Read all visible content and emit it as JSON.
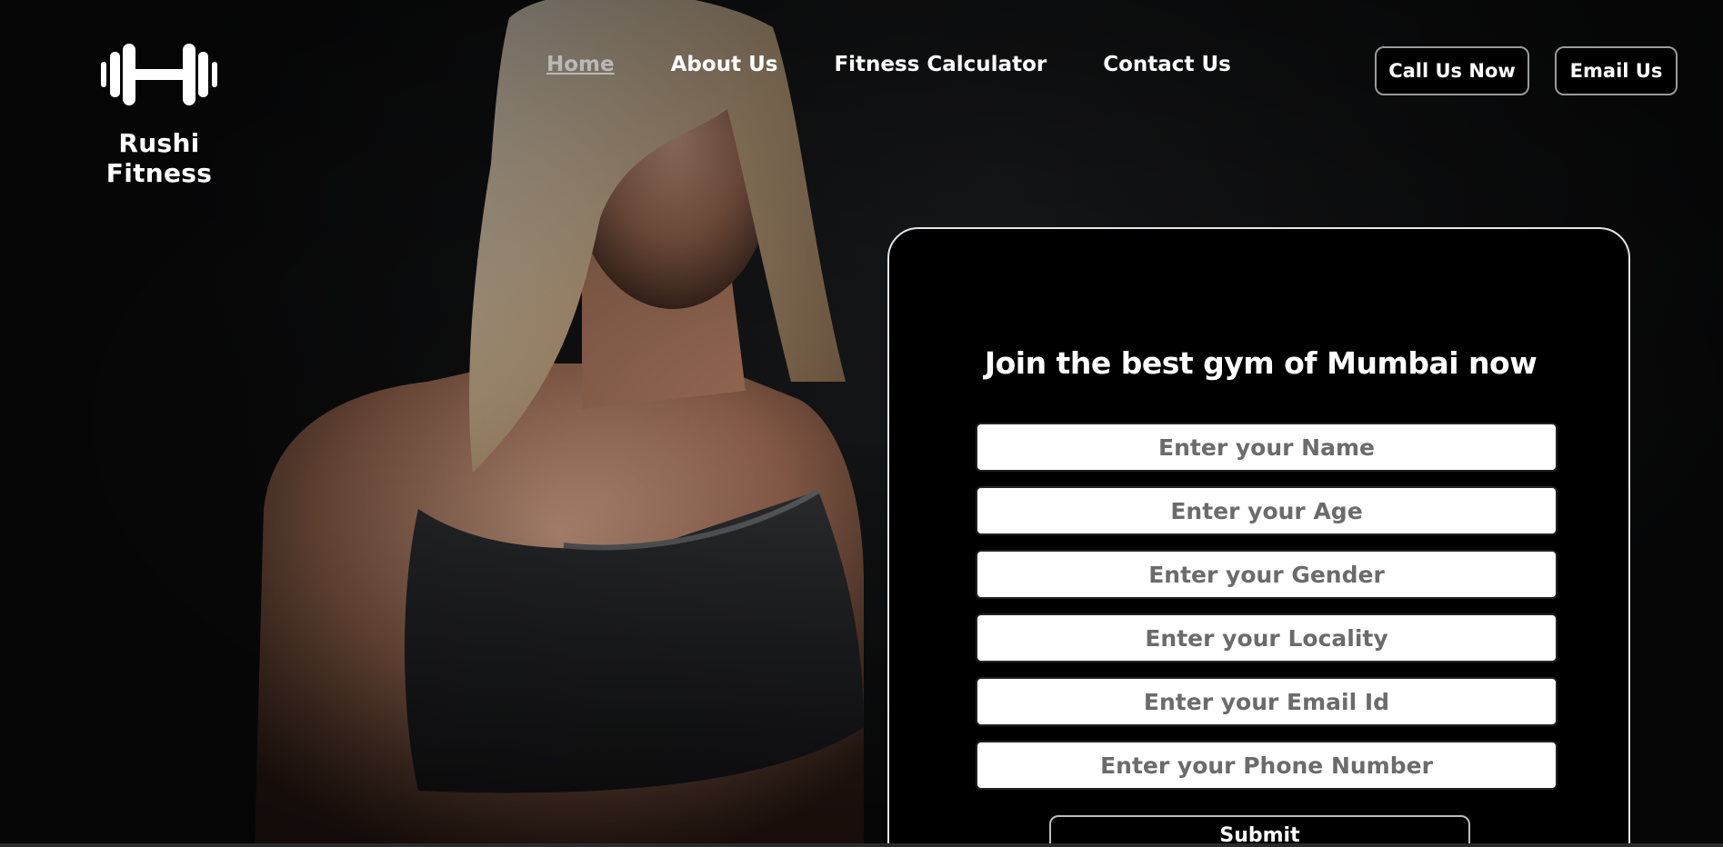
{
  "brand": {
    "name": "Rushi Fitness",
    "logo_icon": "dumbbell-icon"
  },
  "nav": {
    "items": [
      {
        "label": "Home",
        "active": true
      },
      {
        "label": "About Us",
        "active": false
      },
      {
        "label": "Fitness Calculator",
        "active": false
      },
      {
        "label": "Contact Us",
        "active": false
      }
    ]
  },
  "header_actions": {
    "call_label": "Call Us Now",
    "email_label": "Email Us"
  },
  "form": {
    "title": "Join the best gym of Mumbai now",
    "fields": [
      {
        "placeholder": "Enter your Name",
        "value": ""
      },
      {
        "placeholder": "Enter your Age",
        "value": ""
      },
      {
        "placeholder": "Enter your Gender",
        "value": ""
      },
      {
        "placeholder": "Enter your Locality",
        "value": ""
      },
      {
        "placeholder": "Enter your Email Id",
        "value": ""
      },
      {
        "placeholder": "Enter your Phone Number",
        "value": ""
      }
    ],
    "submit_label": "Submit"
  },
  "colors": {
    "background": "#0f0f10",
    "card": "#000000",
    "text": "#ffffff",
    "nav_active": "#b9b9b9",
    "placeholder": "#6b6b6b"
  }
}
